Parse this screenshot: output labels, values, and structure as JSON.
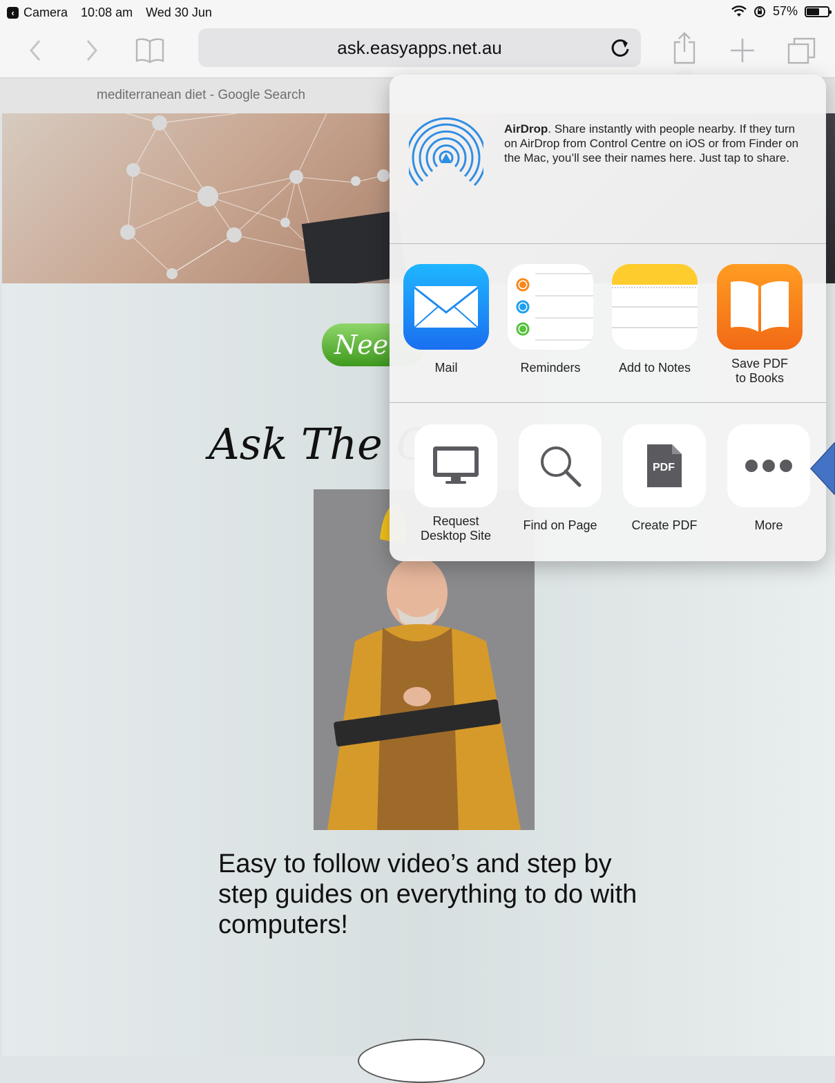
{
  "status_bar": {
    "back_app": "Camera",
    "time": "10:08 am",
    "date": "Wed 30 Jun",
    "battery": "57%",
    "battery_level": 0.57
  },
  "browser": {
    "url": "ask.easyapps.net.au",
    "tab_title": "mediterranean diet - Google Search"
  },
  "page": {
    "need_button_partial": "Nee",
    "title_partial": "Ask The C",
    "tagline": "Easy to follow video’s and step by step guides on everything to do with computers!"
  },
  "share_sheet": {
    "airdrop_bold": "AirDrop",
    "airdrop_text": ". Share instantly with people nearby. If they turn on AirDrop from Control Centre on iOS or from Finder on the Mac, you’ll see their names here. Just tap to share.",
    "apps": [
      {
        "label": "Mail",
        "icon": "mail-icon"
      },
      {
        "label": "Reminders",
        "icon": "reminders-icon"
      },
      {
        "label": "Add to Notes",
        "icon": "notes-icon"
      },
      {
        "label": "Save PDF\nto Books",
        "icon": "books-icon"
      }
    ],
    "actions": [
      {
        "label": "Request\nDesktop Site",
        "icon": "desktop-icon"
      },
      {
        "label": "Find on Page",
        "icon": "search-icon"
      },
      {
        "label": "Create PDF",
        "icon": "pdf-icon",
        "badge": "PDF"
      },
      {
        "label": "More",
        "icon": "more-icon"
      }
    ]
  },
  "colors": {
    "accent_blue": "#2f8de4",
    "mail_blue": "#1f8ef1",
    "books_orange": "#f7881f",
    "notes_yellow": "#ffcc2e",
    "annotation_arrow": "#4472c4"
  }
}
